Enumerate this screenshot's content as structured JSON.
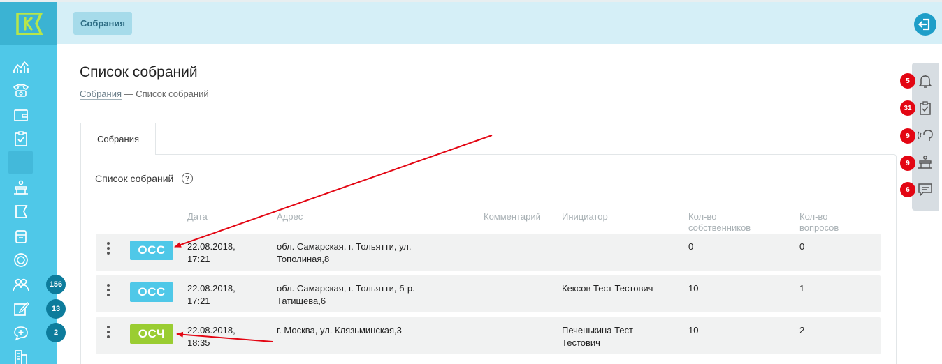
{
  "header": {
    "breadcrumb_chip": "Собрания"
  },
  "page": {
    "title": "Список собраний",
    "breadcrumb_link": "Собрания",
    "breadcrumb_current": "— Список собраний"
  },
  "tabs": [
    {
      "label": "Собрания"
    }
  ],
  "section": {
    "title": "Список собраний",
    "help": "?"
  },
  "table": {
    "columns": [
      "Дата",
      "Адрес",
      "Комментарий",
      "Инициатор",
      "Кол-во собственников",
      "Кол-во вопросов"
    ],
    "col_date": "Дата",
    "col_address": "Адрес",
    "col_comment": "Комментарий",
    "col_initiator": "Инициатор",
    "col_owners_1": "Кол-во",
    "col_owners_2": "собственников",
    "col_questions_1": "Кол-во",
    "col_questions_2": "вопросов",
    "rows": [
      {
        "type": "ОСС",
        "type_color": "#4fc8e8",
        "date_1": "22.08.2018,",
        "date_2": "17:21",
        "address_1": "обл. Самарская, г. Тольятти, ул.",
        "address_2": "Тополиная,8",
        "comment": "",
        "initiator_1": "",
        "initiator_2": "",
        "owners": "0",
        "questions": "0"
      },
      {
        "type": "ОСС",
        "type_color": "#4fc8e8",
        "date_1": "22.08.2018,",
        "date_2": "17:21",
        "address_1": "обл. Самарская, г. Тольятти, б-р.",
        "address_2": "Татищева,6",
        "comment": "",
        "initiator_1": "Кексов Тест Тестович",
        "initiator_2": "",
        "owners": "10",
        "questions": "1"
      },
      {
        "type": "ОСЧ",
        "type_color": "#9acd32",
        "date_1": "22.08.2018,",
        "date_2": "18:35",
        "address_1": "г. Москва, ул. Клязьминская,3",
        "address_2": "",
        "comment": "",
        "initiator_1": "Печенькина Тест",
        "initiator_2": "Тестович",
        "owners": "10",
        "questions": "2"
      }
    ]
  },
  "sidebar": {
    "badges": [
      "156",
      "13",
      "2"
    ],
    "icons": [
      "analytics-icon",
      "phone-icon",
      "wallet-icon",
      "clipboard-check-icon",
      "blank-item",
      "intercom-icon",
      "flag-icon",
      "archive-icon",
      "coin-icon",
      "users-icon",
      "edit-icon",
      "chat-add-icon",
      "building-icon"
    ]
  },
  "notifications": [
    {
      "icon": "bell-icon",
      "count": "5"
    },
    {
      "icon": "clipboard-check-icon",
      "count": "31"
    },
    {
      "icon": "headset-icon",
      "count": "9"
    },
    {
      "icon": "intercom-icon",
      "count": "9"
    },
    {
      "icon": "message-icon",
      "count": "6"
    }
  ],
  "colors": {
    "sidebar": "#4fc8e8",
    "header": "#d5eff7",
    "badge_occ": "#4fc8e8",
    "badge_osch": "#9acd32",
    "notification_badge": "#e30613",
    "annotation_arrow": "#e30613"
  }
}
